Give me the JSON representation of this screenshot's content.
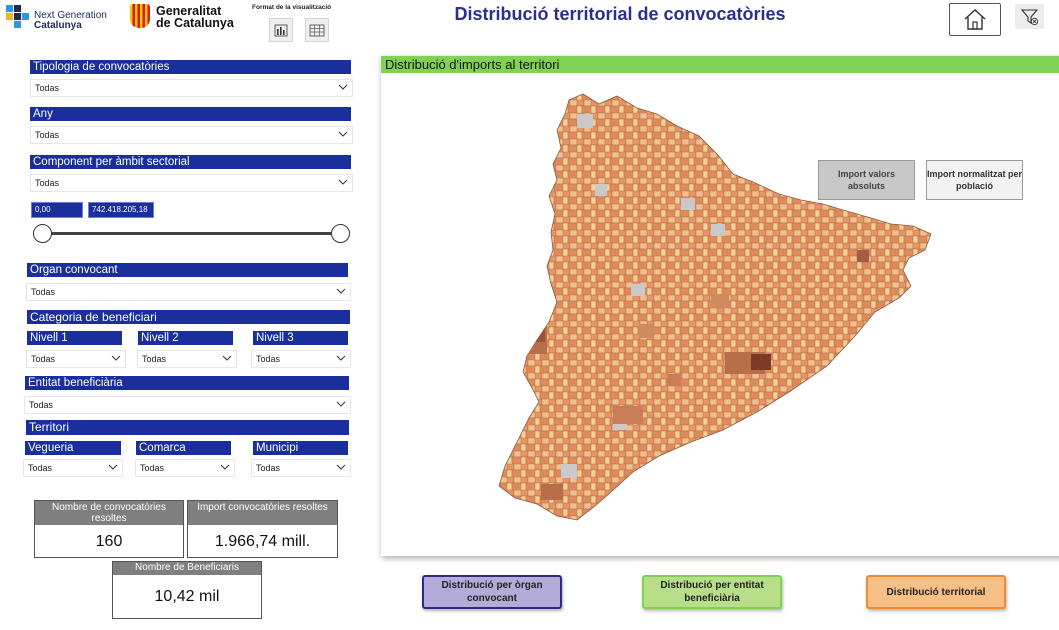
{
  "header": {
    "ngc_line1": "Next Generation",
    "ngc_line2": "Catalunya",
    "gen_line1": "Generalitat",
    "gen_line2": "de Catalunya",
    "format_label": "Format de la visualització",
    "title": "Distribució territorial de convocatòries"
  },
  "filters": {
    "tipologia": {
      "label": "Tipologia de convocatòries",
      "value": "Todas"
    },
    "any": {
      "label": "Any",
      "value": "Todas"
    },
    "component": {
      "label": "Component per àmbit sectorial",
      "value": "Todas"
    },
    "range": {
      "min": "0,00",
      "max": "742.418.205,18"
    },
    "organ": {
      "label": "Organ convocant",
      "value": "Todas"
    },
    "categoria": {
      "label": "Categoria de beneficiari",
      "nivell1": {
        "label": "Nivell 1",
        "value": "Todas"
      },
      "nivell2": {
        "label": "Nivell 2",
        "value": "Todas"
      },
      "nivell3": {
        "label": "Nivell 3",
        "value": "Todas"
      }
    },
    "entitat": {
      "label": "Entitat beneficiària",
      "value": "Todas"
    },
    "territori": {
      "label": "Territori",
      "vegueria": {
        "label": "Vegueria",
        "value": "Todas"
      },
      "comarca": {
        "label": "Comarca",
        "value": "Todas"
      },
      "municipi": {
        "label": "Municipi",
        "value": "Todas"
      }
    }
  },
  "kpis": {
    "convocatories": {
      "label": "Nombre de convocatòries resoltes",
      "value": "160"
    },
    "import": {
      "label": "Import convocatòries resoltes",
      "value": "1.966,74 mill."
    },
    "beneficiaris": {
      "label": "Nombre de Beneficiaris",
      "value": "10,42 mil"
    }
  },
  "map": {
    "title": "Distribució d'imports al territori",
    "btn_absolute": "Import valors absoluts",
    "btn_normalized": "Import normalitzat per població"
  },
  "nav": {
    "organ": "Distribució per òrgan convocant",
    "entitat": "Distribució per entitat beneficiària",
    "territorial": "Distribució territorial"
  },
  "colors": {
    "filter_header": "#1a2f9b",
    "map_header": "#80d252",
    "nav_organ": "#b4acd8",
    "nav_entitat": "#b8de8a",
    "nav_territorial": "#f6bf85"
  }
}
